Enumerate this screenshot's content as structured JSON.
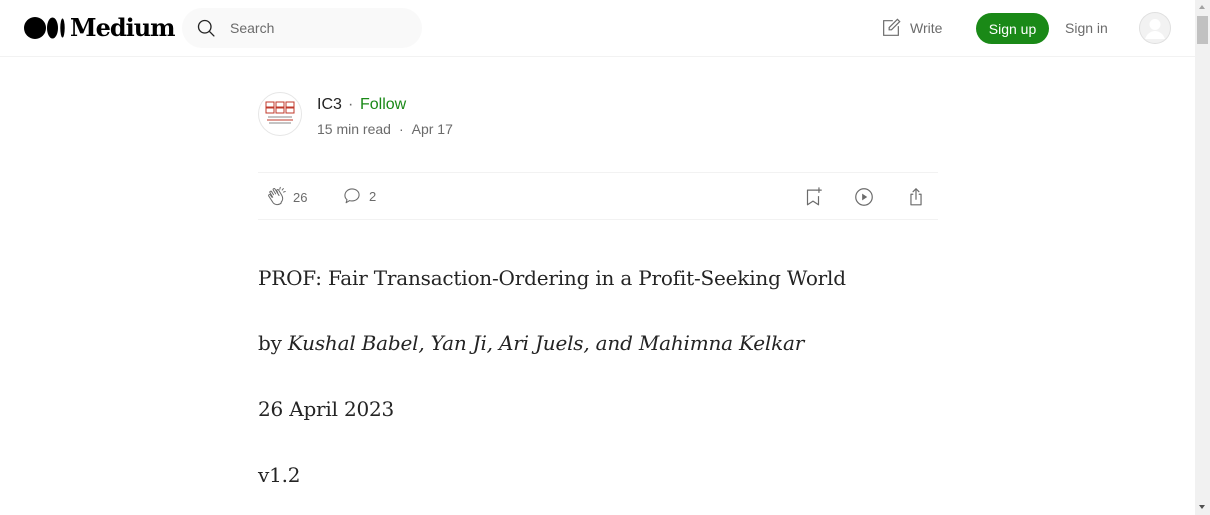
{
  "header": {
    "logo_text": "Medium",
    "search": {
      "placeholder": "Search"
    },
    "write_label": "Write",
    "signup_label": "Sign up",
    "signin_label": "Sign in",
    "accent_color": "#1a8917"
  },
  "post": {
    "author": "IC3",
    "follow_label": "Follow",
    "separator": "·",
    "read_time": "15 min read",
    "date": "Apr 17",
    "claps": "26",
    "responses": "2",
    "icons": [
      "clap-icon",
      "response-icon",
      "bookmark-icon",
      "listen-icon",
      "share-icon"
    ]
  },
  "article": {
    "title": "PROF: Fair Transaction-Ordering in a Profit-Seeking World",
    "byline_prefix": "by",
    "byline_authors": "Kushal Babel, Yan Ji, Ari Juels, and Mahimna Kelkar",
    "date_line": "26 April 2023",
    "version": "v1.2"
  }
}
